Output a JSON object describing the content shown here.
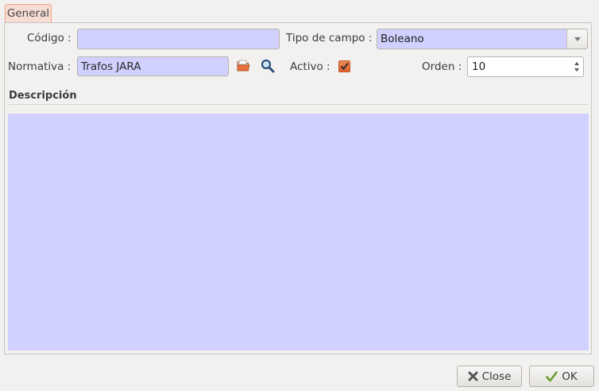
{
  "tabs": [
    {
      "label": "General"
    }
  ],
  "form": {
    "codigo": {
      "label": "Código :",
      "value": ""
    },
    "tipo_campo": {
      "label": "Tipo de campo :",
      "value": "Boleano"
    },
    "normativa": {
      "label": "Normativa :",
      "value": "Trafos JARA"
    },
    "activo": {
      "label": "Activo :",
      "checked": true
    },
    "orden": {
      "label": "Orden :",
      "value": "10"
    }
  },
  "descripcion": {
    "heading": "Descripción",
    "value": ""
  },
  "buttons": {
    "close": "Close",
    "ok": "OK"
  },
  "colors": {
    "field_bg": "#d1d1ff",
    "accent": "#e8733a"
  }
}
